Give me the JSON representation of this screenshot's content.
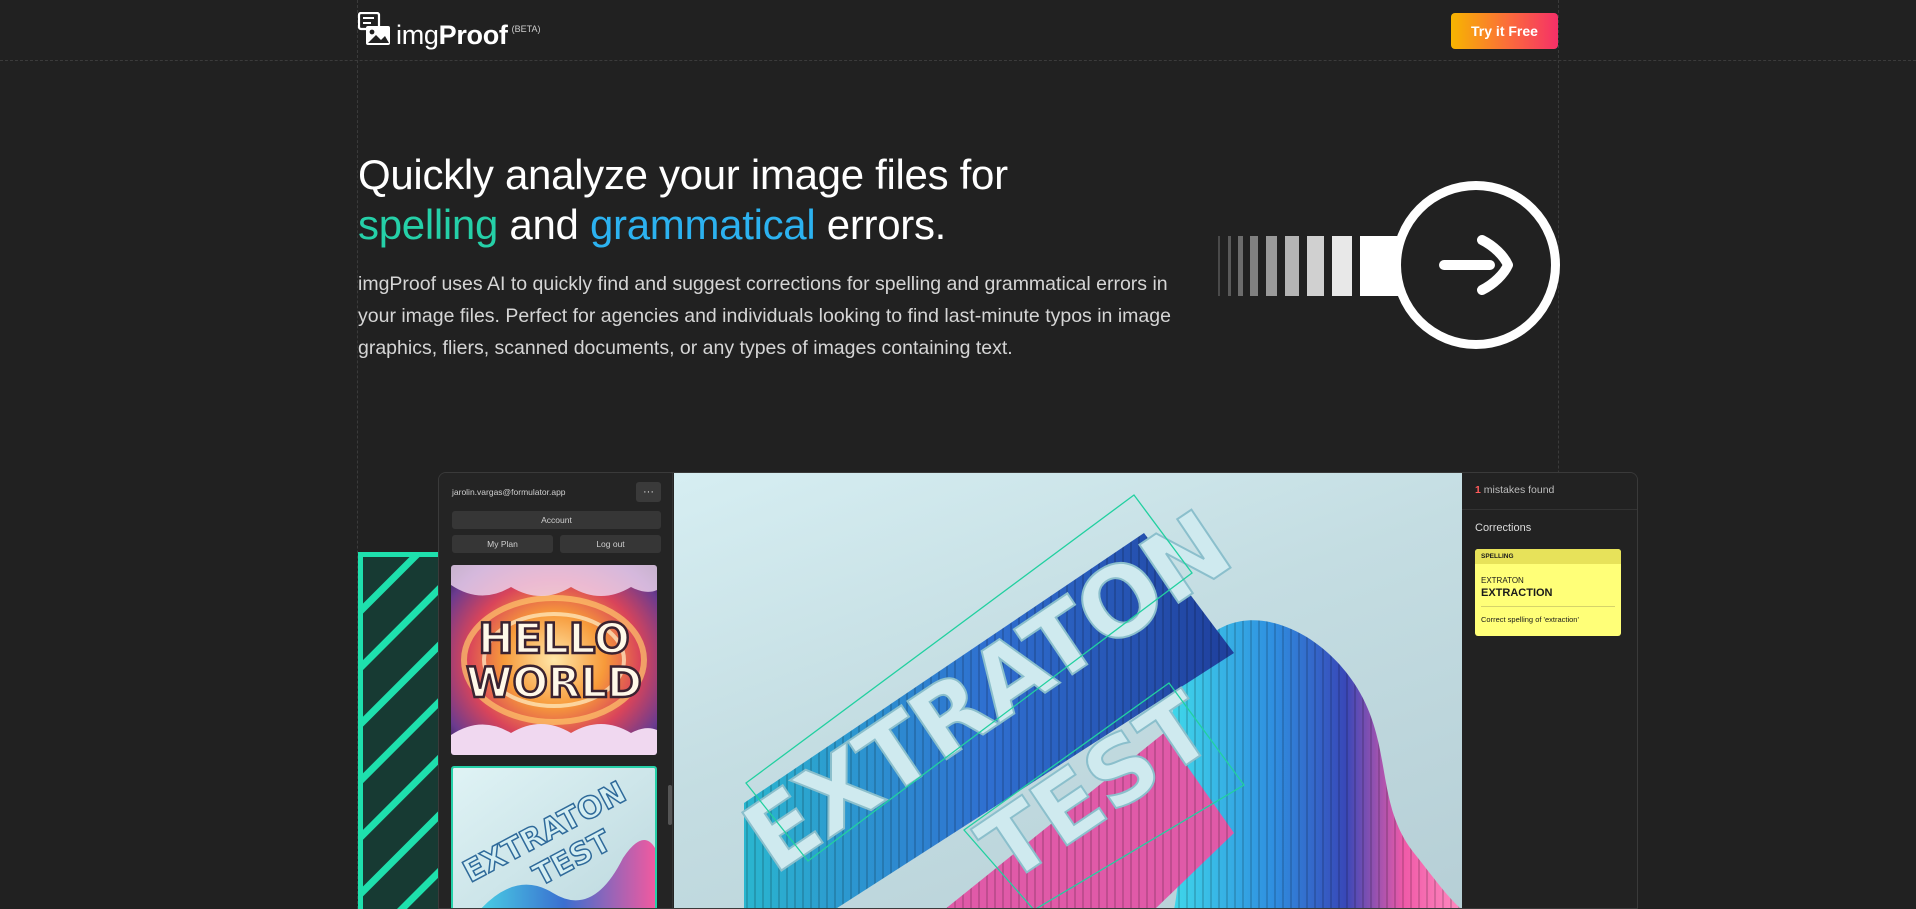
{
  "brand": {
    "name_light": "img",
    "name_bold": "Proof",
    "beta": "(BETA)"
  },
  "header": {
    "cta_label": "Try it Free"
  },
  "hero": {
    "title_line1": "Quickly analyze your image files for",
    "title_word_spelling": "spelling",
    "title_and": "and",
    "title_word_grammatical": "grammatical",
    "title_end": "errors.",
    "description": "imgProof uses AI to quickly find and suggest corrections for spelling and grammatical errors in your image files. Perfect for agencies and individuals looking to find last-minute typos in image graphics, fliers, scanned documents, or any types of images containing text."
  },
  "app": {
    "user_email": "jarolin.vargas@formulator.app",
    "menu_icon": "ellipsis-icon",
    "menu_label": "···",
    "account_label": "Account",
    "plan_label": "My Plan",
    "logout_label": "Log out",
    "thumbnails": [
      {
        "text_line1": "HELLO",
        "text_line2": "WORLD"
      },
      {
        "text_line1": "EXTRATON",
        "text_line2": "TEST"
      }
    ],
    "main_image": {
      "text_line1": "EXTRATON",
      "text_line2": "TEST"
    },
    "mistakes_count": "1",
    "mistakes_label": "mistakes found",
    "corrections_title": "Corrections",
    "correction": {
      "category": "SPELLING",
      "original": "EXTRATON",
      "suggestion": "EXTRACTION",
      "note": "Correct spelling of 'extraction'"
    }
  },
  "colors": {
    "background": "#212121",
    "accent_green": "#25d0a8",
    "accent_blue": "#2cb2f0",
    "cta_gradient_start": "#f7b500",
    "cta_gradient_end": "#f53068",
    "correction_card": "#ffff78",
    "mistake_count": "#ff5b5b"
  }
}
